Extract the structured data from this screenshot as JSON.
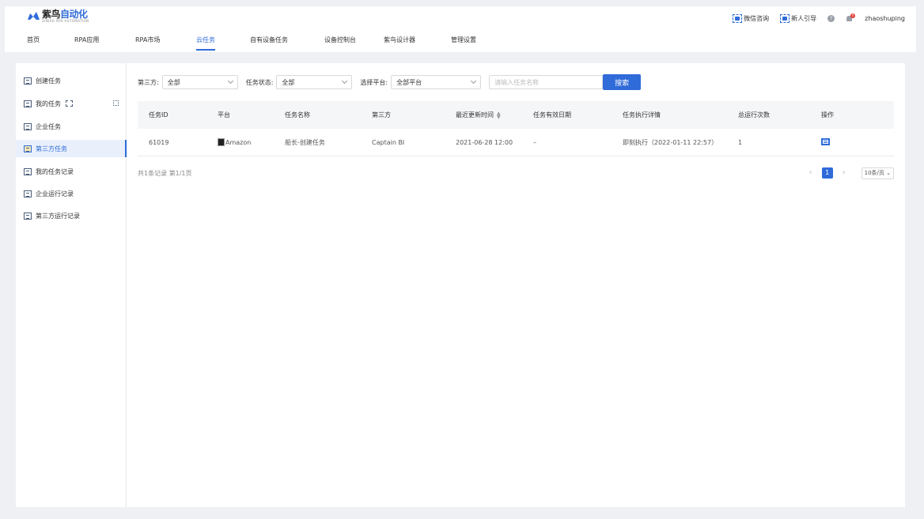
{
  "app": {
    "logo_title_a": "紫鸟",
    "logo_title_b": "自动化",
    "logo_subtitle": "ZINIAO RPA AUTOMATION"
  },
  "nav": {
    "items": [
      {
        "label": "首页",
        "active": false
      },
      {
        "label": "RPA应用",
        "active": false
      },
      {
        "label": "RPA市场",
        "active": false
      },
      {
        "label": "云任务",
        "active": true
      },
      {
        "label": "自有设备任务",
        "active": false
      },
      {
        "label": "设备控制台",
        "active": false
      },
      {
        "label": "紫鸟设计器",
        "active": false
      },
      {
        "label": "管理设置",
        "active": false
      }
    ]
  },
  "top_right": {
    "wechat_label": "微信咨询",
    "guide_label": "新人引导",
    "help_icon": "help-icon",
    "notification_count": "0",
    "username": "zhaoshuping"
  },
  "sidebar": {
    "items": [
      {
        "label": "创建任务",
        "icon": "create-task-icon",
        "active": false
      },
      {
        "label": "我的任务",
        "icon": "my-task-icon",
        "active": false
      },
      {
        "label": "企业任务",
        "icon": "enterprise-task-icon",
        "active": false
      },
      {
        "label": "第三方任务",
        "icon": "third-party-task-icon",
        "active": true
      },
      {
        "label": "我的任务记录",
        "icon": "my-task-record-icon",
        "active": false
      },
      {
        "label": "企业运行记录",
        "icon": "enterprise-run-record-icon",
        "active": false
      },
      {
        "label": "第三方运行记录",
        "icon": "third-party-run-record-icon",
        "active": false
      }
    ]
  },
  "filters": {
    "third_party_label": "第三方:",
    "third_party_value": "全部",
    "status_label": "任务状态:",
    "status_value": "全部",
    "platform_label": "选择平台:",
    "platform_value": "全部平台",
    "search_placeholder": "请输入任务名称",
    "search_button": "搜索"
  },
  "table": {
    "columns": [
      "任务ID",
      "平台",
      "任务名称",
      "第三方",
      "最近更新时间",
      "任务有效日期",
      "任务执行详情",
      "总运行次数",
      "操作"
    ],
    "rows": [
      {
        "id": "61019",
        "platform": "Amazon",
        "name": "船长-创建任务",
        "third_party": "Captain BI",
        "updated": "2021-06-28  12:00",
        "valid_date": "–",
        "exec_detail": "即刻执行（2022-01-11 22:57）",
        "run_count": "1",
        "action_icon": "edit-icon"
      }
    ]
  },
  "footer": {
    "summary": "共1条记录 第1/1页",
    "current_page": "1",
    "page_size": "10条/页"
  },
  "colors": {
    "accent": "#2f6bd9",
    "background": "#eef0f4",
    "header_row": "#f5f6f8",
    "active_side": "#e9f0fc"
  }
}
